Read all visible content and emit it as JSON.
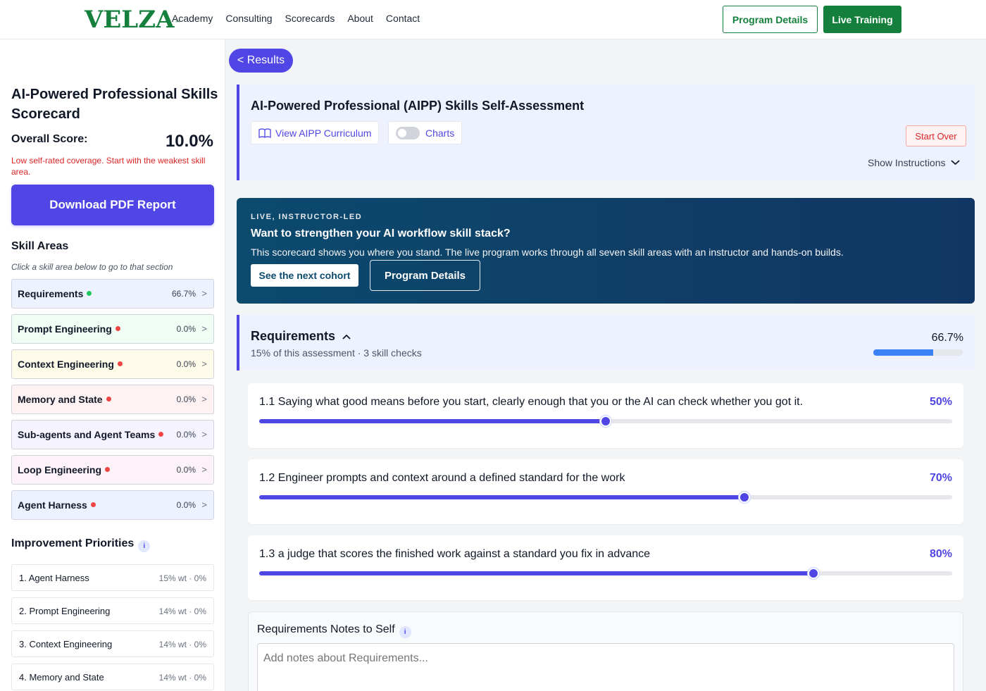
{
  "nav": {
    "logo": "VELZA",
    "logo_mark": "™",
    "links": [
      "Academy",
      "Consulting",
      "Scorecards",
      "About",
      "Contact"
    ],
    "program_details": "Program Details",
    "live_training": "Live Training"
  },
  "sidebar": {
    "title": "AI-Powered Professional Skills Scorecard",
    "overall_label": "Overall Score:",
    "overall_value": "10.0%",
    "overall_note": "Low self-rated coverage. Start with the weakest skill area.",
    "download_pdf": "Download PDF Report",
    "skill_areas_title": "Skill Areas",
    "skill_areas_hint": "Click a skill area below to go to that section",
    "skills": [
      {
        "name": "Requirements",
        "pct": "66.7%",
        "bg": "#eef2ff",
        "dot": "#22c55e"
      },
      {
        "name": "Prompt Engineering",
        "pct": "0.0%",
        "bg": "#f0fdf4",
        "dot": "#ef4444"
      },
      {
        "name": "Context Engineering",
        "pct": "0.0%",
        "bg": "#fefce8",
        "dot": "#ef4444"
      },
      {
        "name": "Memory and State",
        "pct": "0.0%",
        "bg": "#fef2f2",
        "dot": "#ef4444"
      },
      {
        "name": "Sub-agents and Agent Teams",
        "pct": "0.0%",
        "bg": "#f5f3ff",
        "dot": "#ef4444"
      },
      {
        "name": "Loop Engineering",
        "pct": "0.0%",
        "bg": "#fdf2f8",
        "dot": "#ef4444"
      },
      {
        "name": "Agent Harness",
        "pct": "0.0%",
        "bg": "#eef2ff",
        "dot": "#ef4444"
      }
    ],
    "priorities_title": "Improvement Priorities",
    "info_glyph": "i",
    "chevron_glyph": ">",
    "priorities": [
      {
        "name": "1. Agent Harness",
        "meta": "15% wt · 0%"
      },
      {
        "name": "2. Prompt Engineering",
        "meta": "14% wt · 0%"
      },
      {
        "name": "3. Context Engineering",
        "meta": "14% wt · 0%"
      },
      {
        "name": "4. Memory and State",
        "meta": "14% wt · 0%"
      }
    ]
  },
  "main": {
    "results_button": "< Results",
    "header": {
      "title": "AI-Powered Professional (AIPP) Skills Self-Assessment",
      "view_curriculum": "View AIPP Curriculum",
      "charts_label": "Charts",
      "start_over": "Start Over",
      "show_instructions": "Show Instructions"
    },
    "promo": {
      "eyebrow": "LIVE, INSTRUCTOR-LED",
      "title": "Want to strengthen your AI workflow skill stack?",
      "text": "This scorecard shows you where you stand. The live program works through all seven skill areas with an instructor and hands-on builds.",
      "cta_cohort": "See the next cohort",
      "cta_details": "Program Details"
    },
    "section": {
      "title": "Requirements",
      "subtitle": "15% of this assessment · 3 skill checks",
      "pct_label": "66.7%",
      "progress": 0.667
    },
    "questions": [
      {
        "text": "1.1 Saying what good means before you start, clearly enough that you or the AI can check whether you got it.",
        "pct_label": "50%",
        "value": 0.5
      },
      {
        "text": "1.2 Engineer prompts and context around a defined standard for the work",
        "pct_label": "70%",
        "value": 0.7
      },
      {
        "text": "1.3 a judge that scores the finished work against a standard you fix in advance",
        "pct_label": "80%",
        "value": 0.8
      }
    ],
    "notes": {
      "title": "Requirements Notes to Self",
      "placeholder": "Add notes about Requirements..."
    }
  },
  "colors": {
    "brand_green": "#15803d",
    "accent_indigo": "#4f46e5",
    "danger": "#dc2626",
    "promo_navy": "#0c4a6e"
  },
  "icons": [
    "book-open-icon",
    "toggle-switch-icon",
    "chevron-down-icon",
    "chevron-up-icon",
    "info-icon",
    "chevron-right-icon",
    "status-dot-icon"
  ]
}
